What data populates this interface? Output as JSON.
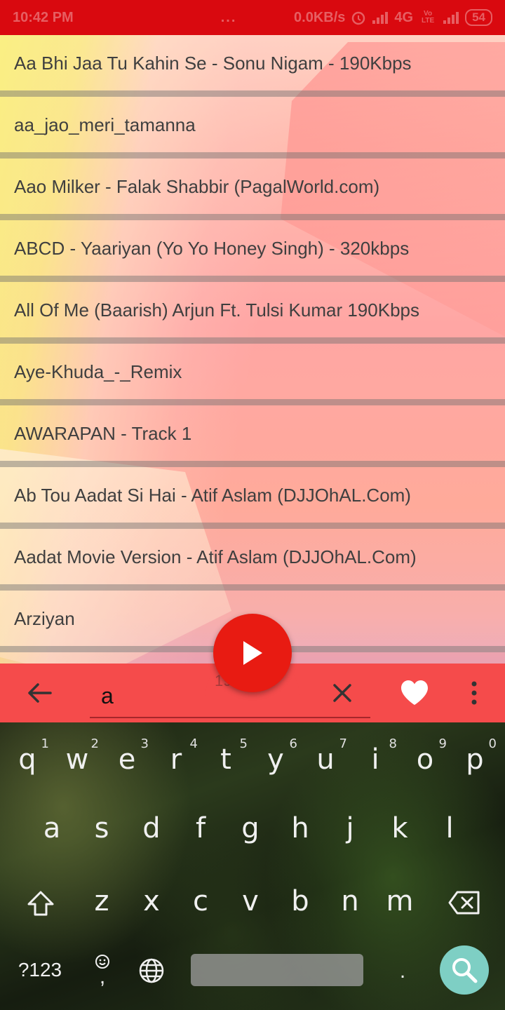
{
  "status_bar": {
    "time": "10:42 PM",
    "dots": "...",
    "network_speed": "0.0KB/s",
    "network_type": "4G",
    "volte": "Vo LTE",
    "battery": "54"
  },
  "songs": [
    "Aa Bhi Jaa Tu Kahin Se - Sonu Nigam - 190Kbps",
    "aa_jao_meri_tamanna",
    "Aao Milker - Falak Shabbir (PagalWorld.com)",
    "ABCD - Yaariyan (Yo Yo Honey Singh) - 320kbps",
    "All Of Me (Baarish) Arjun Ft. Tulsi Kumar 190Kbps",
    "Aye-Khuda_-_Remix",
    "AWARAPAN - Track 1",
    "Ab Tou Aadat Si Hai - Atif Aslam (DJJOhAL.Com)",
    "Aadat Movie Version - Atif Aslam (DJJOhAL.Com)",
    "Arziyan"
  ],
  "control_bar": {
    "search_value": "a",
    "behind_text": "19...",
    "icons": [
      "arrow-left-icon",
      "close-icon",
      "heart-icon",
      "more-vertical-icon",
      "play-icon"
    ]
  },
  "keyboard": {
    "row1": [
      {
        "key": "q",
        "hint": "1"
      },
      {
        "key": "w",
        "hint": "2"
      },
      {
        "key": "e",
        "hint": "3"
      },
      {
        "key": "r",
        "hint": "4"
      },
      {
        "key": "t",
        "hint": "5"
      },
      {
        "key": "y",
        "hint": "6"
      },
      {
        "key": "u",
        "hint": "7"
      },
      {
        "key": "i",
        "hint": "8"
      },
      {
        "key": "o",
        "hint": "9"
      },
      {
        "key": "p",
        "hint": "0"
      }
    ],
    "row2": [
      "a",
      "s",
      "d",
      "f",
      "g",
      "h",
      "j",
      "k",
      "l"
    ],
    "row3": [
      "z",
      "x",
      "c",
      "v",
      "b",
      "n",
      "m"
    ],
    "symbols_label": "?123",
    "emoji_comma": ",",
    "period": ".",
    "colors": {
      "search_key": "#7ecfc4",
      "accent": "#f54b4b",
      "fab": "#e81b12"
    }
  }
}
